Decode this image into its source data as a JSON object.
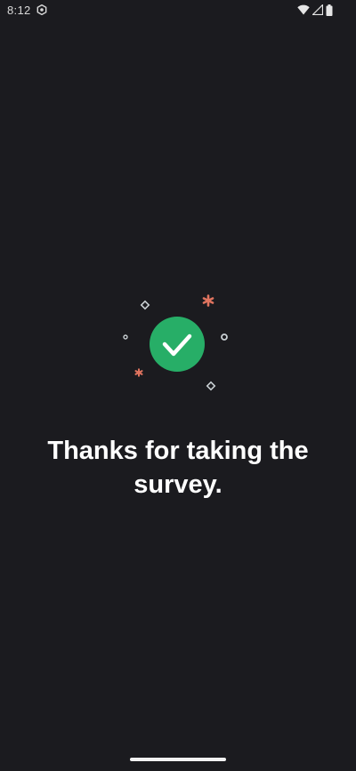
{
  "status_bar": {
    "time": "8:12",
    "icons": [
      "settings-icon",
      "wifi-icon",
      "cellular-signal-icon",
      "battery-icon"
    ]
  },
  "graphic": {
    "icon": "checkmark-circle-icon",
    "accent_color": "#27ae67",
    "confetti_colors": [
      "#e0745f",
      "#c9d0d3"
    ]
  },
  "message": {
    "text": "Thanks for taking the survey."
  }
}
